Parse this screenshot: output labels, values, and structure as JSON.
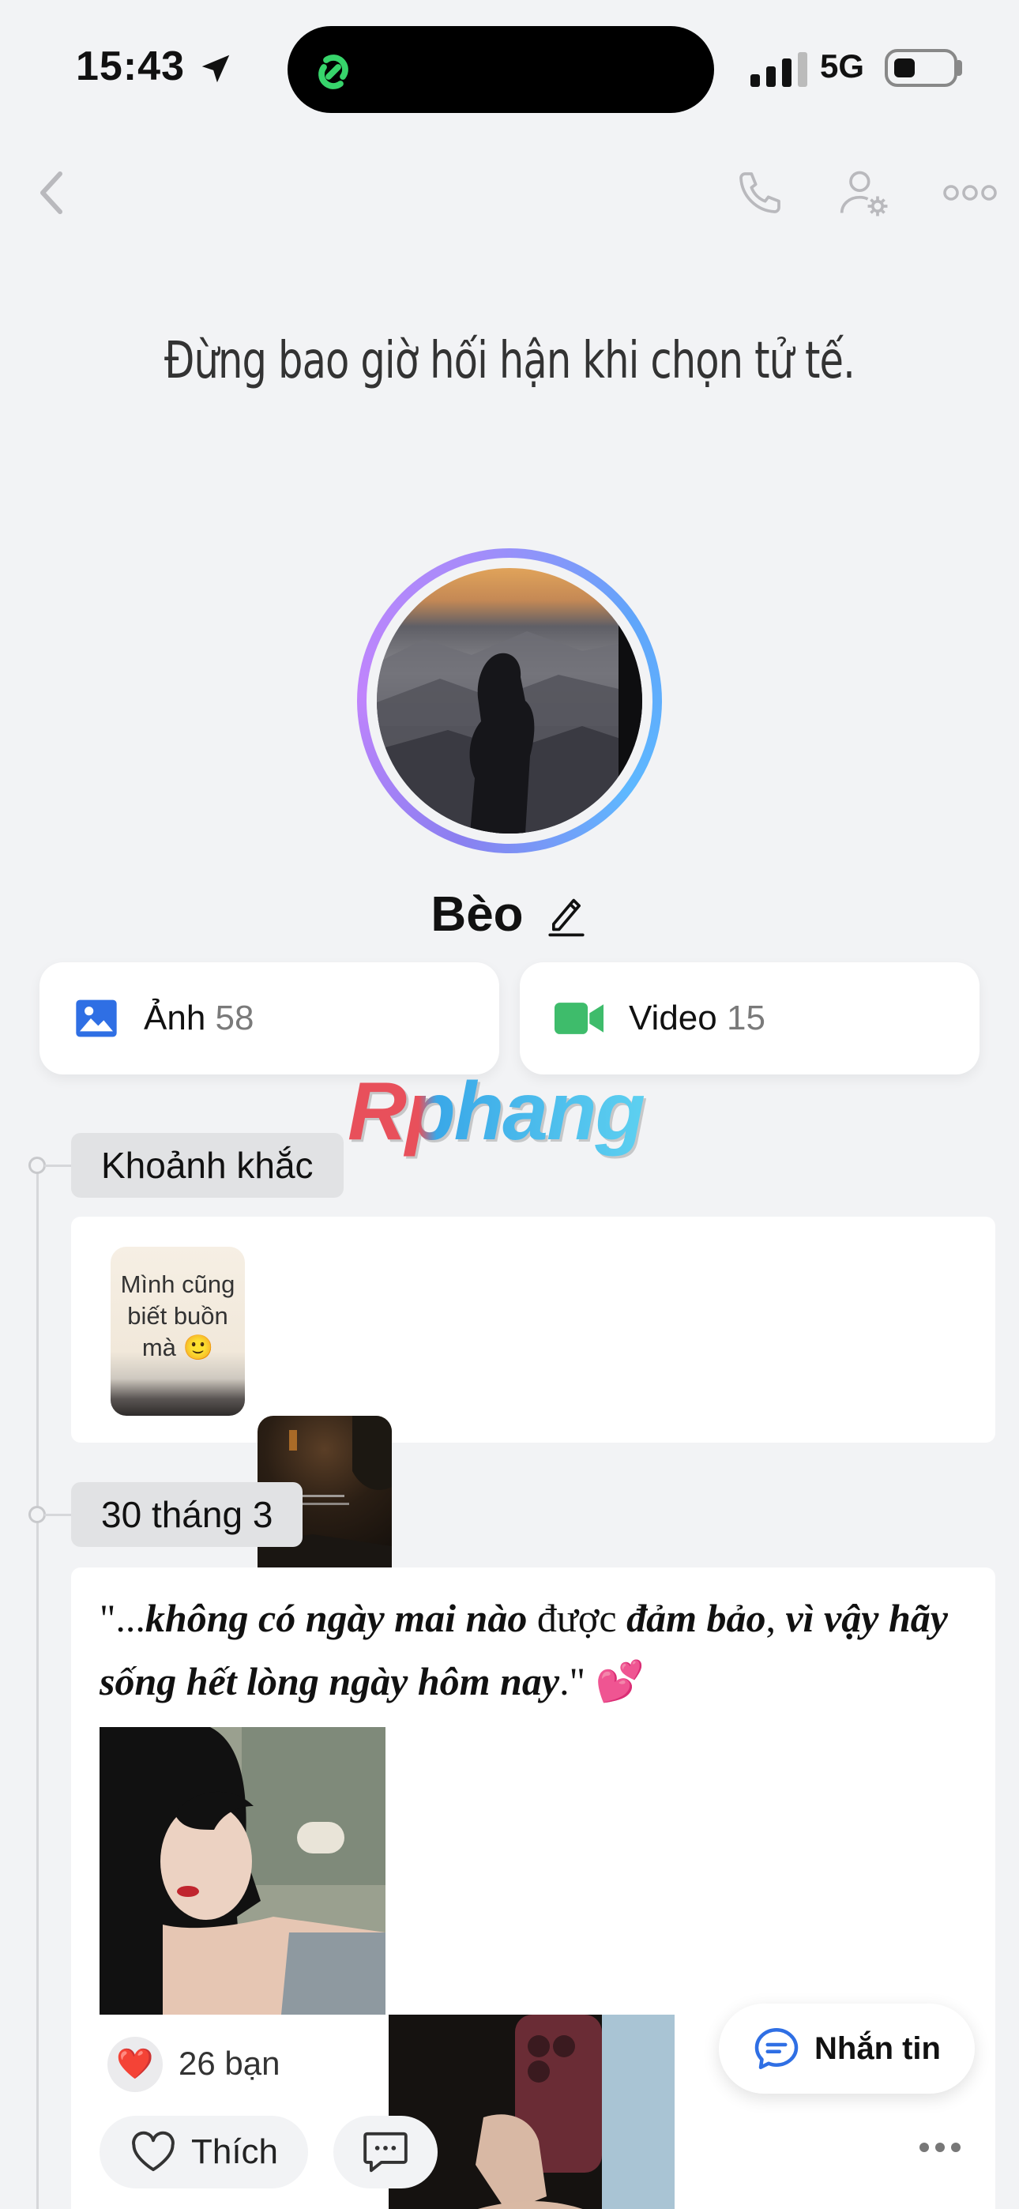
{
  "status_bar": {
    "time": "15:43",
    "network": "5G"
  },
  "cover": {
    "quote": "Đừng bao giờ hối hận khi chọn tử tế."
  },
  "profile": {
    "name": "Bèo"
  },
  "media": {
    "photos": {
      "label": "Ảnh",
      "count": "58"
    },
    "videos": {
      "label": "Video",
      "count": "15"
    }
  },
  "watermark": "Rphang",
  "moments": {
    "label": "Khoảnh khắc",
    "items": [
      {
        "text": "Mình cũng biết buồn mà 🙂",
        "style": "light"
      },
      {
        "text": "",
        "style": "dark"
      }
    ]
  },
  "post": {
    "date_label": "30 tháng 3",
    "quote_open": "\"...",
    "quote_body_1": "không có ngày mai nào",
    "quote_mid": " được ",
    "quote_body_2": "đảm bảo",
    "quote_sep": ", ",
    "quote_body_3": "vì vậy hãy sống hết lòng ngày hôm nay",
    "quote_close": ".\" 💕",
    "reactions": {
      "emoji": "❤️",
      "text": "26 bạn"
    },
    "like_label": "Thích"
  },
  "message_button": {
    "label": "Nhắn tin"
  },
  "colors": {
    "accent": "#2f6fe4",
    "video_green": "#3ebc6b",
    "heart": "#e0245e"
  }
}
